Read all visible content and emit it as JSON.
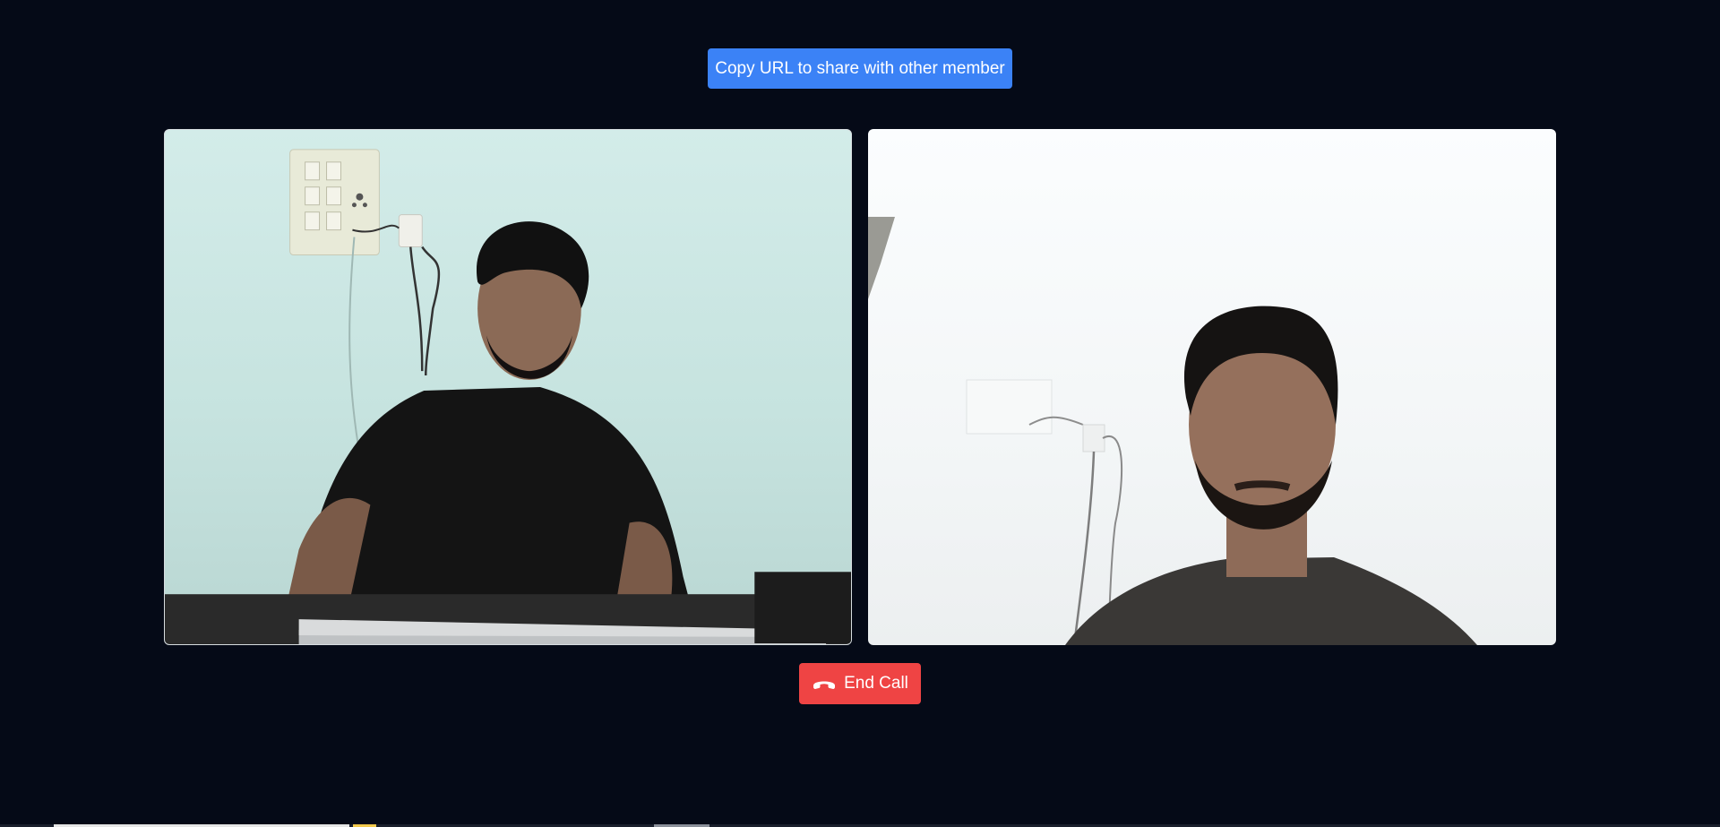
{
  "header": {
    "share_label": "Copy URL to share with other member"
  },
  "videos": {
    "local_label": "",
    "remote_label": ""
  },
  "controls": {
    "end_call_label": "End Call",
    "end_call_icon": "phone-hangup-icon"
  },
  "colors": {
    "background": "#050a17",
    "share_button": "#3b82f6",
    "end_call_button": "#ef4444",
    "button_text": "#ffffff"
  }
}
